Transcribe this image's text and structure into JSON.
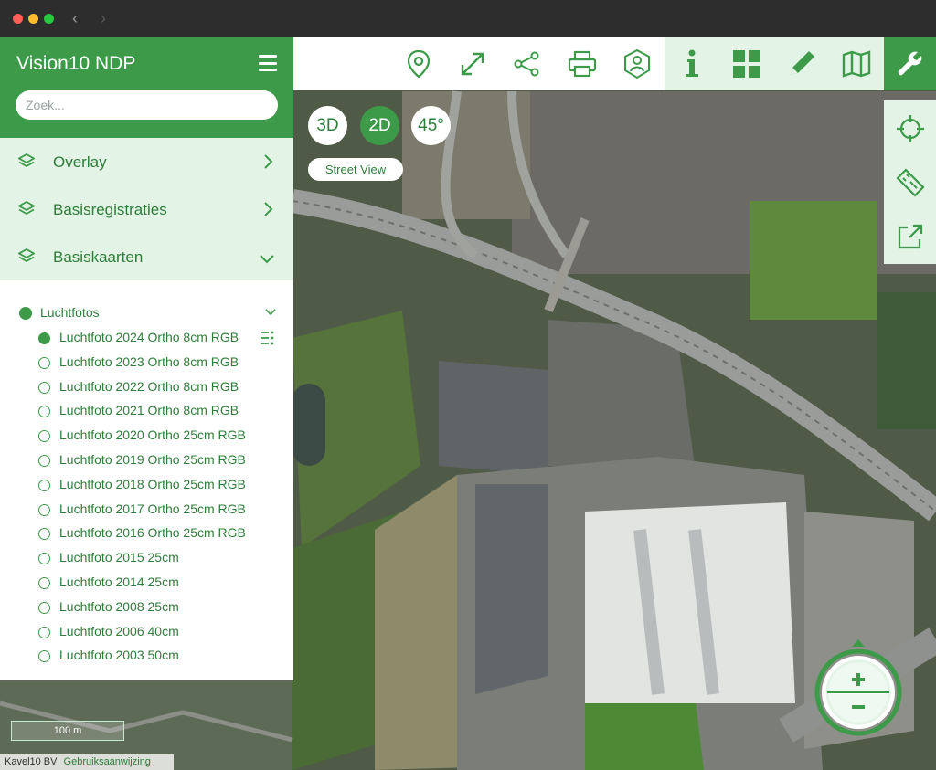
{
  "app": {
    "title": "Vision10 NDP",
    "search_placeholder": "Zoek..."
  },
  "categories": [
    {
      "label": "Overlay",
      "state": "collapsed"
    },
    {
      "label": "Basisregistraties",
      "state": "collapsed"
    },
    {
      "label": "Basiskaarten",
      "state": "expanded"
    }
  ],
  "group": {
    "label": "Luchtfotos",
    "items": [
      {
        "label": "Luchtfoto 2024 Ortho 8cm RGB",
        "selected": true
      },
      {
        "label": "Luchtfoto 2023 Ortho 8cm RGB",
        "selected": false
      },
      {
        "label": "Luchtfoto 2022 Ortho 8cm RGB",
        "selected": false
      },
      {
        "label": "Luchtfoto 2021 Ortho 8cm RGB",
        "selected": false
      },
      {
        "label": "Luchtfoto 2020 Ortho 25cm RGB",
        "selected": false
      },
      {
        "label": "Luchtfoto 2019 Ortho 25cm RGB",
        "selected": false
      },
      {
        "label": "Luchtfoto 2018 Ortho 25cm RGB",
        "selected": false
      },
      {
        "label": "Luchtfoto 2017 Ortho 25cm RGB",
        "selected": false
      },
      {
        "label": "Luchtfoto 2016 Ortho 25cm RGB",
        "selected": false
      },
      {
        "label": "Luchtfoto 2015 25cm",
        "selected": false
      },
      {
        "label": "Luchtfoto 2014 25cm",
        "selected": false
      },
      {
        "label": "Luchtfoto 2008 25cm",
        "selected": false
      },
      {
        "label": "Luchtfoto 2006 40cm",
        "selected": false
      },
      {
        "label": "Luchtfoto 2003 50cm",
        "selected": false
      }
    ]
  },
  "view_modes": {
    "three_d": "3D",
    "two_d": "2D",
    "oblique": "45°",
    "active": "2D",
    "street_view": "Street View"
  },
  "toolbar_icons": [
    "location-pin-icon",
    "expand-icon",
    "share-icon",
    "print-icon",
    "user-shield-icon",
    "info-icon",
    "grid-icon",
    "pencil-icon",
    "map-icon",
    "wrench-icon"
  ],
  "side_tools": [
    "crosshair-icon",
    "ruler-icon",
    "external-link-icon"
  ],
  "map": {
    "scale_label": "100 m",
    "attribution_owner": "Kavel10 BV",
    "attribution_link": "Gebruiksaanwijzing"
  },
  "colors": {
    "brand_green": "#3c9a48",
    "light_green": "#e3f4e6",
    "text_green": "#2f7d3a"
  }
}
